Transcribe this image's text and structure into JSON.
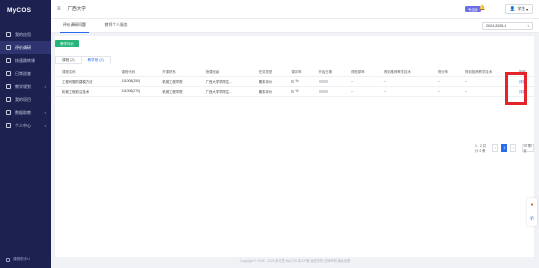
{
  "app": {
    "logo": "MyCOS"
  },
  "sidebar": {
    "items": [
      {
        "label": "我的应用",
        "icon": "home-icon",
        "active": false
      },
      {
        "label": "评价调研",
        "icon": "evaluate-icon",
        "active": true
      },
      {
        "label": "快速跳转课",
        "icon": "bookmark-icon",
        "active": false
      },
      {
        "label": "日常巡查",
        "icon": "calendar-icon",
        "active": false
      },
      {
        "label": "教学规划",
        "icon": "plan-icon",
        "active": false,
        "arrow": "▾"
      },
      {
        "label": "我的项目",
        "icon": "project-icon",
        "active": false
      },
      {
        "label": "数据助教",
        "icon": "data-icon",
        "active": false,
        "arrow": "▾"
      },
      {
        "label": "个人中心",
        "icon": "user-icon",
        "active": false,
        "arrow": "▾"
      }
    ],
    "footer": "课程助手U"
  },
  "header": {
    "school": "广西大学",
    "badge": "专业版",
    "user": "学生"
  },
  "page_tabs": [
    {
      "label": "评价调研问题",
      "active": true
    },
    {
      "label": "教师个人服务",
      "active": false
    }
  ],
  "term": "2024-2025-1",
  "content": {
    "eval_button": "教学评价",
    "sub_tabs": [
      {
        "label": "课程 (2)",
        "active": false
      },
      {
        "label": "教学班 (2)",
        "active": true
      }
    ],
    "columns": [
      "课程名称",
      "课程代码",
      "开课院系",
      "授课班级",
      "任务类型",
      "课评率",
      "开始日期",
      "得账原率",
      "得到推荐教学技术",
      "得分率",
      "得到推荐教学技术",
      "操作"
    ],
    "rows": [
      {
        "name": "工程问题的建模方法",
        "code": "111008(250)",
        "dept": "机械工程学院",
        "cls": "广西大学学院生...",
        "type": "期末评价",
        "rate": "%",
        "c1": "--",
        "c2": "--",
        "c3": "--",
        "c4": "--",
        "op": "详情"
      },
      {
        "name": "机械工程前沿技术",
        "code": "111008(270)",
        "dept": "机械工程学院",
        "cls": "广西大学学院生...",
        "type": "期末评价",
        "rate": "%",
        "c1": "--",
        "c2": "--",
        "c3": "--",
        "c4": "--",
        "op": "详情"
      }
    ],
    "pager": {
      "summary": "1 - 2 共计 2 条",
      "page": "1",
      "size": "10 条/页",
      "prev": "‹",
      "next": "›"
    }
  },
  "footer": "Copyright © 2006 - 2023 麦可思 MyCOS 粤ICP备 版权所有 法律声明 隐私政策"
}
